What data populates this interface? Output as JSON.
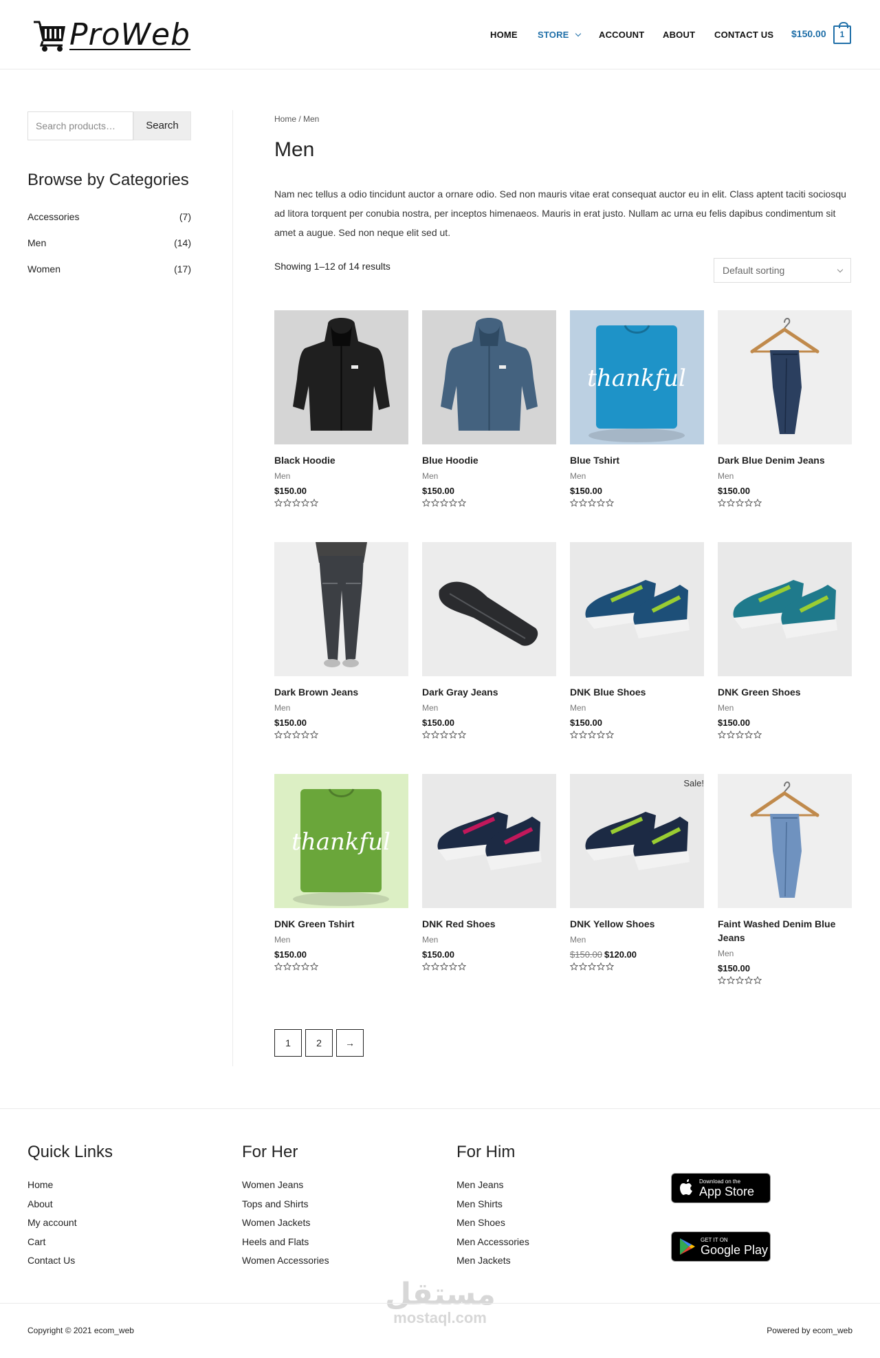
{
  "header": {
    "logo_text": "ProWeb",
    "nav": [
      {
        "label": "HOME"
      },
      {
        "label": "STORE"
      },
      {
        "label": "ACCOUNT"
      },
      {
        "label": "ABOUT"
      },
      {
        "label": "CONTACT US"
      }
    ],
    "cart_total": "$150.00",
    "cart_count": "1",
    "accent_color": "#1f6fa8"
  },
  "sidebar": {
    "search_placeholder": "Search products…",
    "search_button": "Search",
    "browse_title": "Browse by Categories",
    "categories": [
      {
        "name": "Accessories",
        "count": "(7)"
      },
      {
        "name": "Men",
        "count": "(14)"
      },
      {
        "name": "Women",
        "count": "(17)"
      }
    ]
  },
  "main": {
    "breadcrumb": "Home / Men",
    "title": "Men",
    "description": "Nam nec tellus a odio tincidunt auctor a ornare odio. Sed non mauris vitae erat consequat auctor eu in elit. Class aptent taciti sociosqu ad litora torquent per conubia nostra, per inceptos himenaeos. Mauris in erat justo. Nullam ac urna eu felis dapibus condimentum sit amet a augue. Sed non neque elit sed ut.",
    "result_count": "Showing 1–12 of 14 results",
    "sort_label": "Default sorting",
    "products": [
      {
        "name": "Black Hoodie",
        "category": "Men",
        "price": "$150.00",
        "image": "black-hoodie",
        "rating": 0
      },
      {
        "name": "Blue Hoodie",
        "category": "Men",
        "price": "$150.00",
        "image": "blue-hoodie",
        "rating": 0
      },
      {
        "name": "Blue Tshirt",
        "category": "Men",
        "price": "$150.00",
        "image": "blue-tshirt",
        "rating": 0
      },
      {
        "name": "Dark Blue Denim Jeans",
        "category": "Men",
        "price": "$150.00",
        "image": "dark-denim-hanger",
        "rating": 0
      },
      {
        "name": "Dark Brown Jeans",
        "category": "Men",
        "price": "$150.00",
        "image": "brown-jeans-model",
        "rating": 0
      },
      {
        "name": "Dark Gray Jeans",
        "category": "Men",
        "price": "$150.00",
        "image": "gray-jeans-folded",
        "rating": 0
      },
      {
        "name": "DNK Blue Shoes",
        "category": "Men",
        "price": "$150.00",
        "image": "blue-shoes",
        "rating": 0
      },
      {
        "name": "DNK Green Shoes",
        "category": "Men",
        "price": "$150.00",
        "image": "green-shoes",
        "rating": 0
      },
      {
        "name": "DNK Green Tshirt",
        "category": "Men",
        "price": "$150.00",
        "image": "green-tshirt",
        "rating": 0
      },
      {
        "name": "DNK Red Shoes",
        "category": "Men",
        "price": "$150.00",
        "image": "red-shoes",
        "rating": 0
      },
      {
        "name": "DNK Yellow Shoes",
        "category": "Men",
        "old_price": "$150.00",
        "price": "$120.00",
        "badge": "Sale!",
        "image": "yellow-shoes",
        "rating": 0
      },
      {
        "name": "Faint Washed Denim Blue Jeans",
        "category": "Men",
        "price": "$150.00",
        "image": "faint-denim-hanger",
        "rating": 0
      }
    ],
    "tshirt_print": "thankful",
    "pagination": [
      "1",
      "2",
      "→"
    ]
  },
  "footer": {
    "columns": [
      {
        "title": "Quick Links",
        "links": [
          "Home",
          "About",
          "My account",
          "Cart",
          "Contact Us"
        ]
      },
      {
        "title": "For Her",
        "links": [
          "Women Jeans",
          "Tops and Shirts",
          "Women Jackets",
          "Heels and Flats",
          "Women Accessories"
        ]
      },
      {
        "title": "For Him",
        "links": [
          "Men Jeans",
          "Men Shirts",
          "Men Shoes",
          "Men Accessories",
          "Men Jackets"
        ]
      }
    ],
    "app_store": {
      "small": "Download on the",
      "big": "App Store"
    },
    "google_play": {
      "small": "GET IT ON",
      "big": "Google Play"
    },
    "copyright": "Copyright © 2021 ecom_web",
    "powered": "Powered by ecom_web",
    "watermark_ar": "مستقل",
    "watermark_en": "mostaql.com"
  }
}
